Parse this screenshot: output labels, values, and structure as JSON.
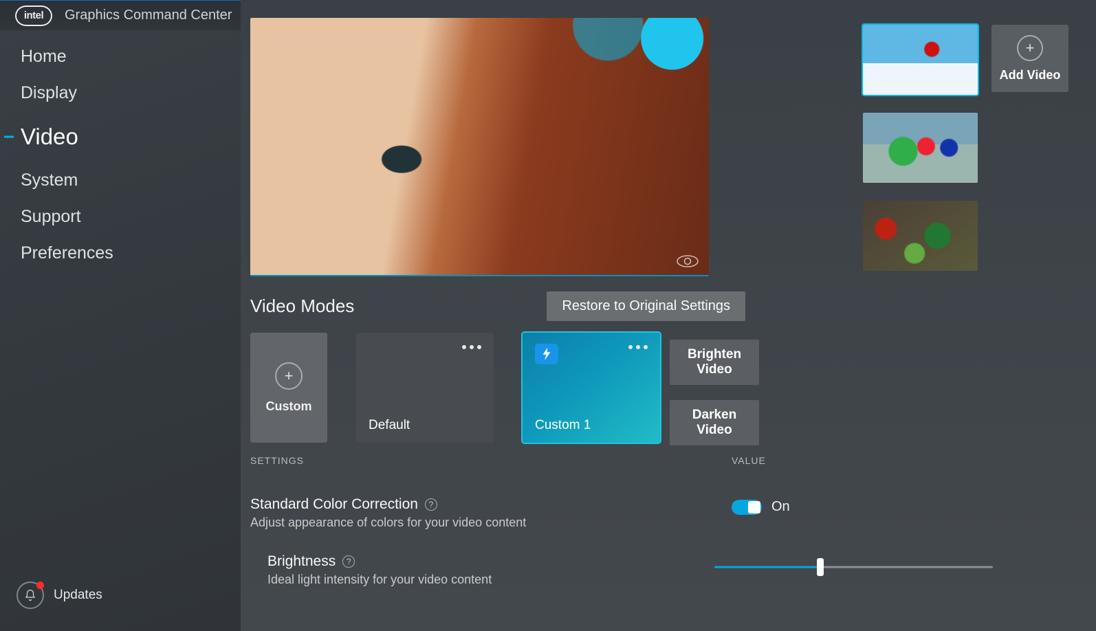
{
  "titlebar": {
    "logo_text": "intel",
    "app_title": "Graphics Command Center"
  },
  "sidebar": {
    "items": [
      {
        "label": "Home"
      },
      {
        "label": "Display"
      },
      {
        "label": "Video"
      },
      {
        "label": "System"
      },
      {
        "label": "Support"
      },
      {
        "label": "Preferences"
      }
    ],
    "active_index": 2,
    "updates_label": "Updates"
  },
  "add_video": {
    "label": "Add Video"
  },
  "modes": {
    "title": "Video Modes",
    "restore_label": "Restore to Original Settings",
    "custom_add_label": "Custom",
    "cards": [
      {
        "label": "Default"
      },
      {
        "label": "Custom 1"
      }
    ],
    "quick": {
      "brighten": "Brighten Video",
      "darken": "Darken Video"
    }
  },
  "settings": {
    "col_settings": "SETTINGS",
    "col_value": "VALUE",
    "scc": {
      "title": "Standard Color Correction",
      "desc": "Adjust appearance of colors for your video content",
      "value_label": "On"
    },
    "brightness": {
      "title": "Brightness",
      "desc": "Ideal light intensity for your video content"
    }
  }
}
